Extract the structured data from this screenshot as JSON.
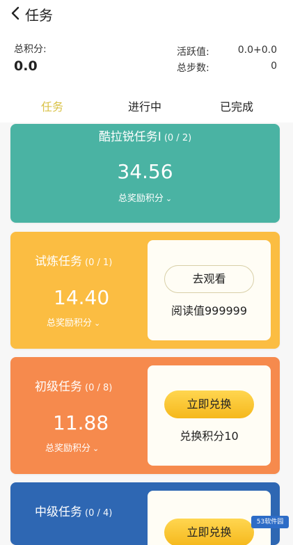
{
  "header": {
    "title": "任务"
  },
  "stats": {
    "total_points_label": "总积分:",
    "total_points_value": "0.0",
    "activity_label": "活跃值:",
    "activity_value": "0.0+0.0",
    "steps_label": "总步数:",
    "steps_value": "0"
  },
  "tabs": [
    {
      "label": "任务",
      "active": true
    },
    {
      "label": "进行中",
      "active": false
    },
    {
      "label": "已完成",
      "active": false
    }
  ],
  "tasks": [
    {
      "name": "酷拉锐任务I",
      "count": "(0 / 2)",
      "score": "34.56",
      "reward_label": "总奖励积分",
      "color": "#4ab3a3"
    },
    {
      "name": "试炼任务",
      "count": "(0 / 1)",
      "score": "14.40",
      "reward_label": "总奖励积分",
      "button_label": "去观看",
      "info": "阅读值999999",
      "color": "#fbbd42"
    },
    {
      "name": "初级任务",
      "count": "(0 / 8)",
      "score": "11.88",
      "reward_label": "总奖励积分",
      "button_label": "立即兑换",
      "info": "兑换积分10",
      "color": "#f68a4d"
    },
    {
      "name": "中级任务",
      "count": "(0 / 4)",
      "button_label": "立即兑换",
      "color": "#2e67b3"
    }
  ],
  "watermark": "53软件园"
}
